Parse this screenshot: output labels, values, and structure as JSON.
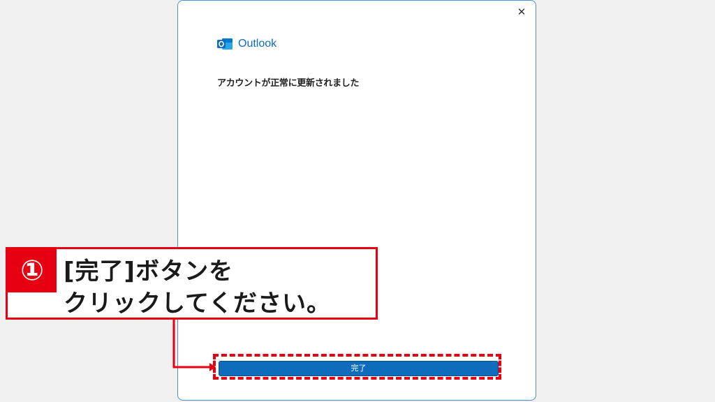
{
  "dialog": {
    "close_glyph": "✕",
    "brand": {
      "icon": "outlook-icon",
      "label": "Outlook",
      "color": "#0f6cbd"
    },
    "message": "アカウントが正常に更新されました",
    "finish_button": "完了"
  },
  "annotation": {
    "step_number": "①",
    "line1": "[完了]ボタンを",
    "line2": "クリックしてください。",
    "accent_color": "#e60012"
  }
}
